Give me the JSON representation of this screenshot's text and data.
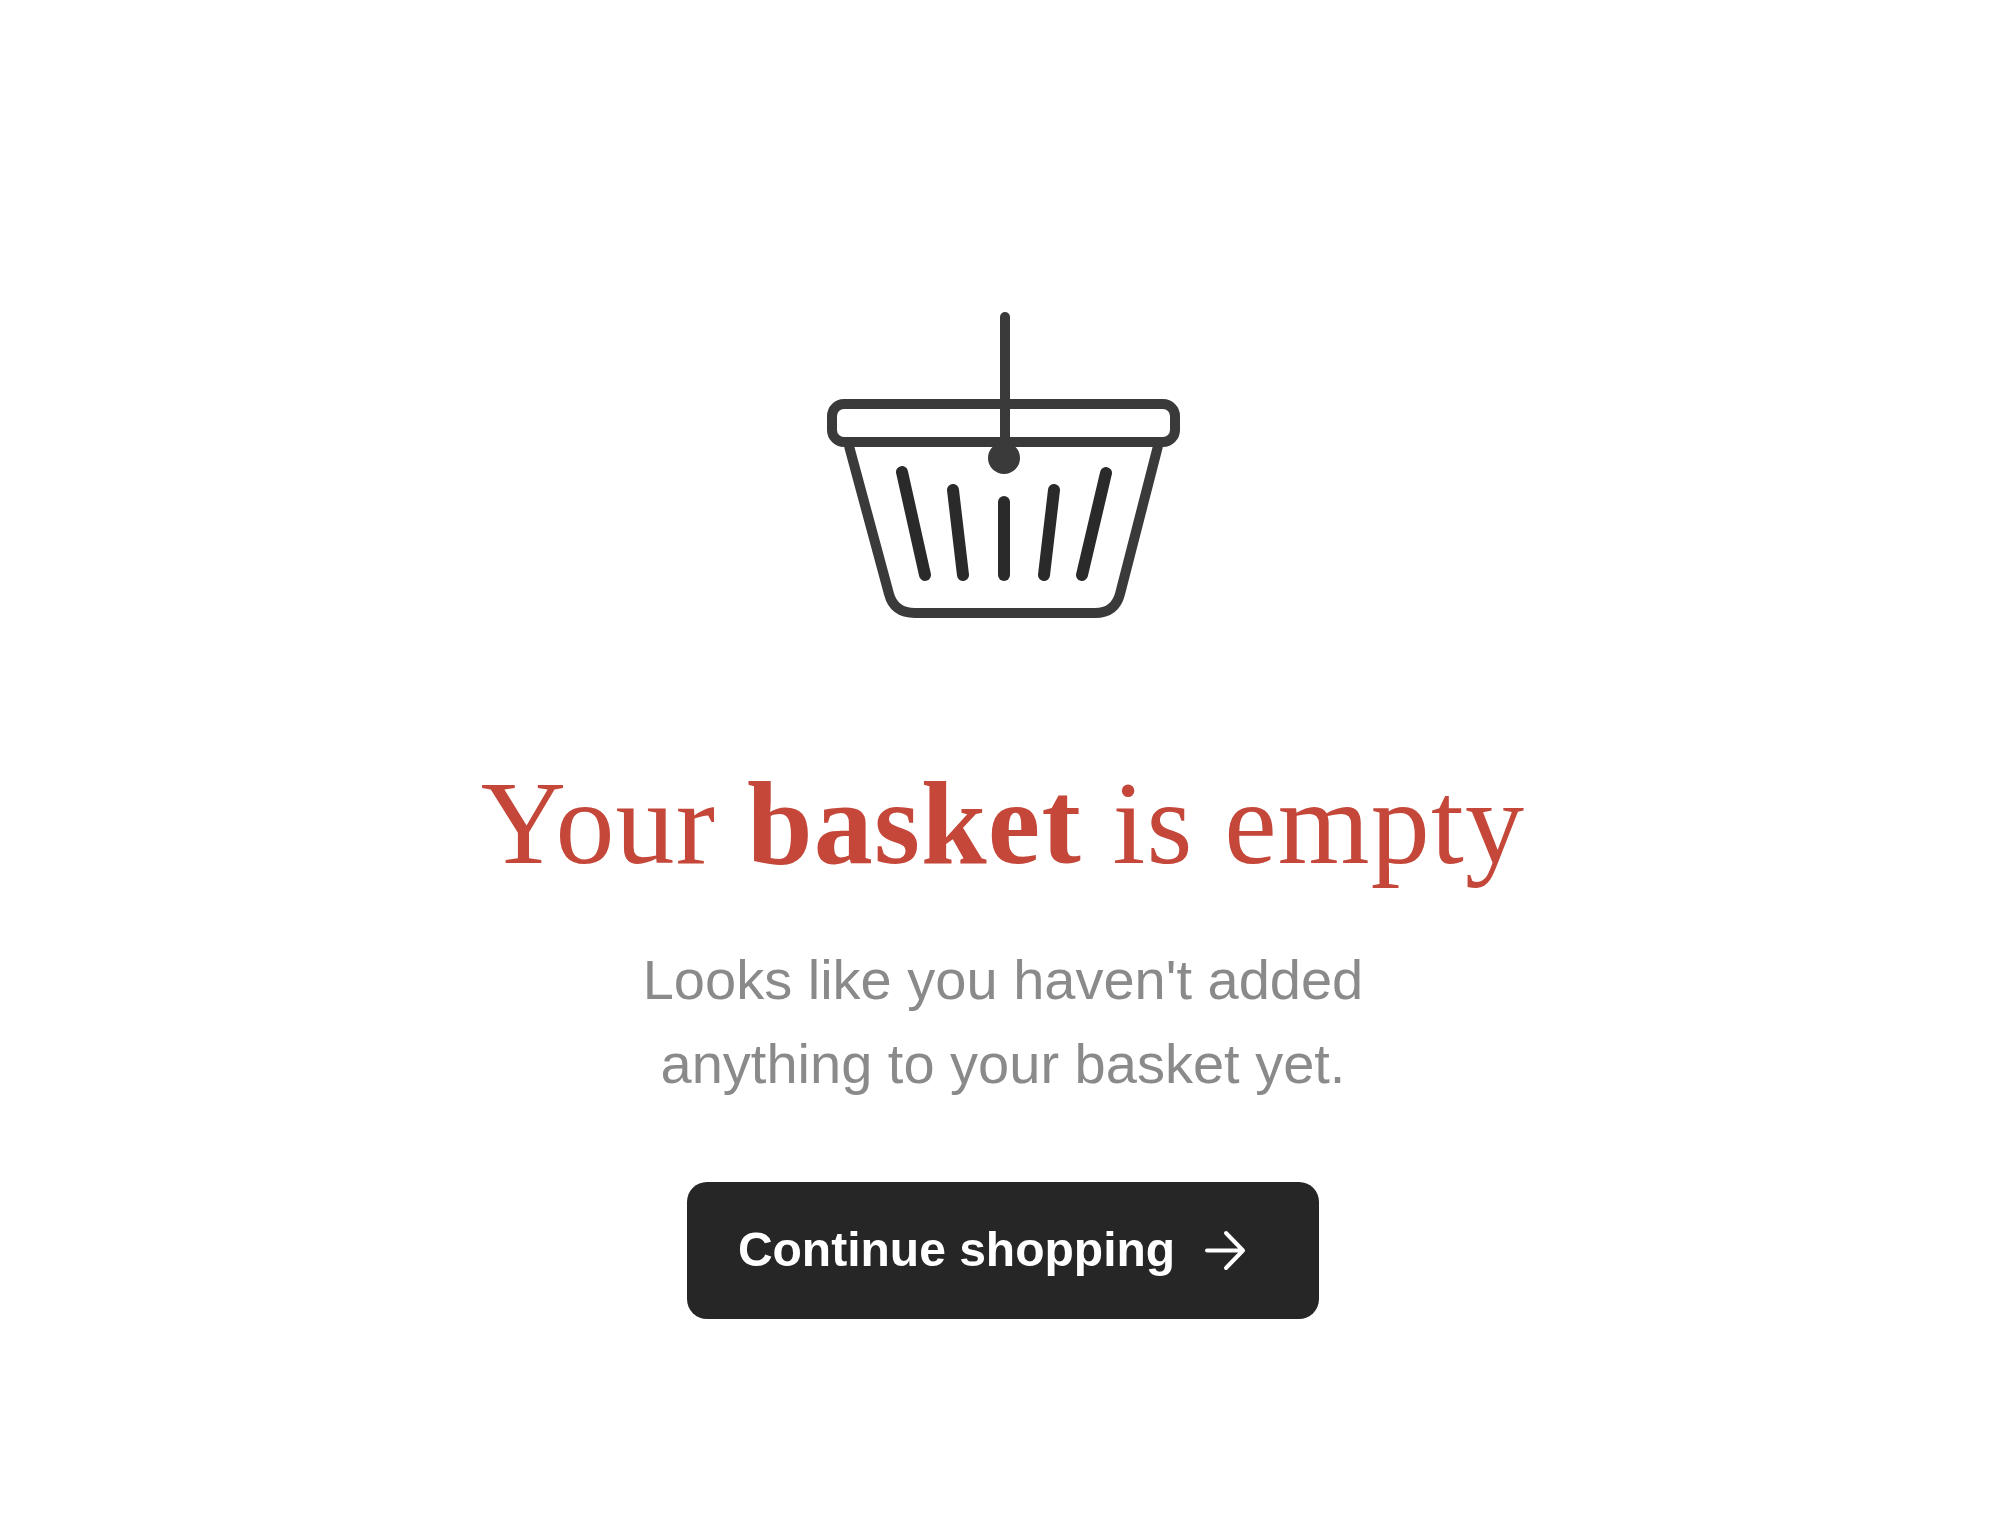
{
  "empty_state": {
    "title": "Your **basket** is empty",
    "message": "Looks like you haven't added anything to your basket yet.",
    "button": {
      "label": "Continue shopping"
    }
  }
}
